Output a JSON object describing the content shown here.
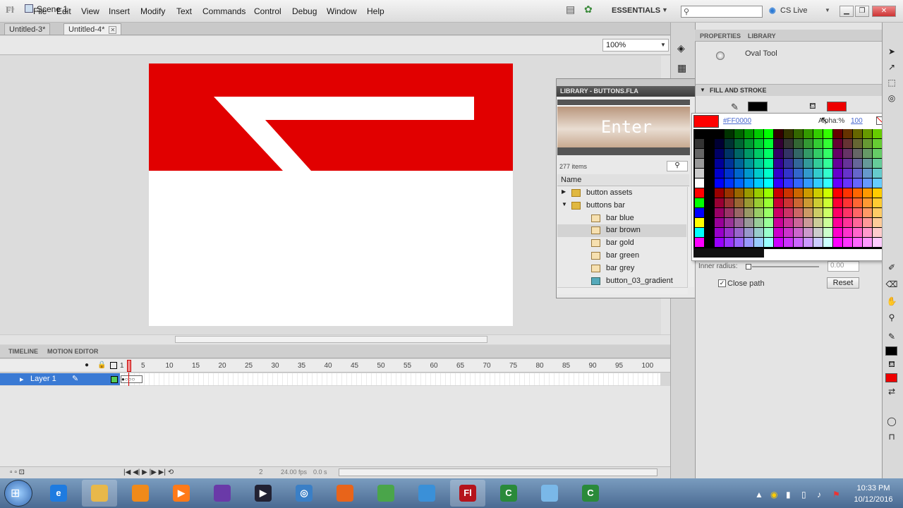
{
  "menubar": {
    "items": [
      "File",
      "Edit",
      "View",
      "Insert",
      "Modify",
      "Text",
      "Commands",
      "Control",
      "Debug",
      "Window",
      "Help"
    ],
    "workspace": "ESSENTIALS",
    "cs_live": "CS Live",
    "app_logo": "Fl"
  },
  "documents": [
    {
      "label": "Untitled-3*",
      "active": false
    },
    {
      "label": "Untitled-4*",
      "active": true
    }
  ],
  "editbar": {
    "scene": "Scene 1",
    "zoom": "100%"
  },
  "stage": {
    "background": "#ffffff",
    "shape_color": "#e10000"
  },
  "timeline": {
    "tabs": [
      "TIMELINE",
      "MOTION EDITOR"
    ],
    "frame_numbers": [
      "1",
      "5",
      "10",
      "15",
      "20",
      "25",
      "30",
      "35",
      "40",
      "45",
      "50",
      "55",
      "60",
      "65",
      "70",
      "75",
      "80",
      "85",
      "90",
      "95",
      "100"
    ],
    "layer": "Layer 1",
    "current_frame": "2",
    "fps": "24.00 fps",
    "time": "0.0 s"
  },
  "library": {
    "title": "LIBRARY - BUTTONS.FLA",
    "preview_label": "Enter",
    "count": "277 items",
    "column": "Name",
    "items": [
      {
        "name": "button assets",
        "type": "folder",
        "indent": 0,
        "selected": false
      },
      {
        "name": "buttons bar",
        "type": "folder-open",
        "indent": 0,
        "selected": false
      },
      {
        "name": "bar blue",
        "type": "symbol",
        "indent": 1,
        "selected": false
      },
      {
        "name": "bar brown",
        "type": "symbol",
        "indent": 1,
        "selected": true
      },
      {
        "name": "bar gold",
        "type": "symbol",
        "indent": 1,
        "selected": false
      },
      {
        "name": "bar green",
        "type": "symbol",
        "indent": 1,
        "selected": false
      },
      {
        "name": "bar grey",
        "type": "symbol",
        "indent": 1,
        "selected": false
      },
      {
        "name": "button_03_gradient",
        "type": "bitmap",
        "indent": 1,
        "selected": false
      }
    ]
  },
  "properties": {
    "tabs": [
      "PROPERTIES",
      "LIBRARY"
    ],
    "tool": "Oval Tool",
    "section": "FILL AND STROKE",
    "stroke_color": "#000000",
    "fill_color": "#e00000",
    "picker": {
      "hex": "#FF0000",
      "alpha_label": "Alpha:%",
      "alpha": "100"
    },
    "inner_radius_label": "Inner radius:",
    "inner_radius_value": "0.00",
    "close_path": "Close path",
    "reset": "Reset"
  },
  "taskbar": {
    "time": "10:33 PM",
    "date": "10/12/2016"
  }
}
